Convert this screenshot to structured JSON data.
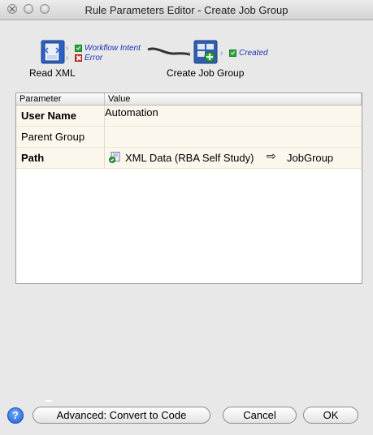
{
  "window": {
    "title": "Rule Parameters Editor - Create Job Group"
  },
  "workflow": {
    "source_node": {
      "label": "Read XML",
      "icon": "xml-document-icon",
      "ports": [
        {
          "status": "ok",
          "label": "Workflow Intent"
        },
        {
          "status": "error",
          "label": "Error"
        }
      ]
    },
    "target_node": {
      "label": "Create Job Group",
      "icon": "create-job-group-icon",
      "ports": [
        {
          "status": "ok",
          "label": "Created"
        }
      ]
    }
  },
  "table": {
    "columns": [
      "Parameter",
      "Value"
    ],
    "rows": [
      {
        "parameter": "User Name",
        "value": "Automation",
        "bold": true
      },
      {
        "parameter": "Parent Group",
        "value": "",
        "bold": false
      },
      {
        "parameter": "Path",
        "value": "XML Data (RBA Self Study)",
        "target": "JobGroup",
        "bold": true
      }
    ]
  },
  "footer": {
    "help_label": "?",
    "advanced_label": "Advanced: Convert to Code",
    "cancel_label": "Cancel",
    "ok_label": "OK"
  },
  "colors": {
    "port_text": "#1a33b8",
    "row_background": "#fbf7ec",
    "help_blue": "#1f5fd6"
  }
}
